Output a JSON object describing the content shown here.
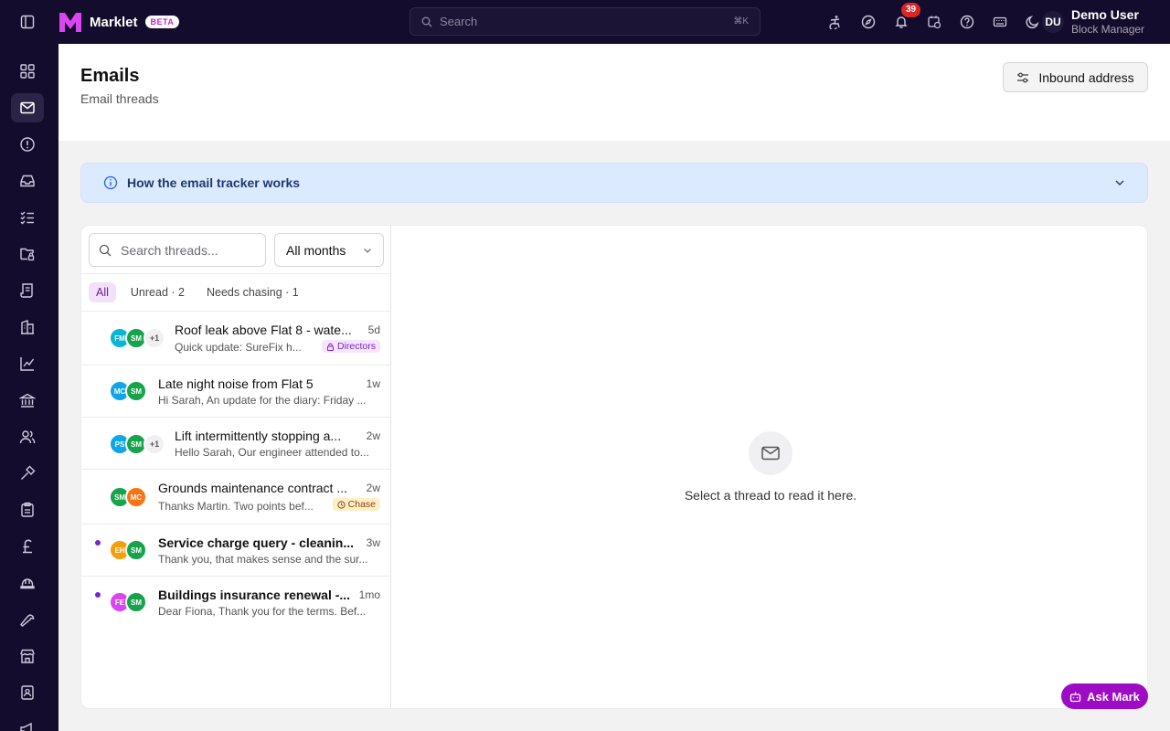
{
  "app": {
    "name": "Marklet",
    "badge": "BETA",
    "brand_color": "#c026d3"
  },
  "search": {
    "placeholder": "Search",
    "shortcut": "⌘K"
  },
  "top_icons": [
    "accessibility-icon",
    "compass-icon",
    "bell-icon",
    "calendar-clock-icon",
    "help-icon",
    "keyboard-icon",
    "moon-icon"
  ],
  "notifications": {
    "count": "39"
  },
  "user": {
    "initials": "DU",
    "name": "Demo User",
    "role": "Block Manager",
    "avatar_color": "#1f1a3a"
  },
  "nav": {
    "items": [
      "dashboard",
      "emails",
      "alerts",
      "inbox",
      "tasks",
      "folders",
      "documents",
      "buildings",
      "reports",
      "finance",
      "people",
      "hammer",
      "clipboard",
      "pound",
      "hard-hat",
      "wrench",
      "store",
      "contacts",
      "megaphone"
    ],
    "active": "emails"
  },
  "page": {
    "title": "Emails",
    "subtitle": "Email threads",
    "inbound_button": "Inbound address"
  },
  "banner": {
    "text": "How the email tracker works"
  },
  "list": {
    "search_placeholder": "Search threads...",
    "month_filter": "All months",
    "filters": [
      {
        "label": "All",
        "active": true
      },
      {
        "label": "Unread · 2",
        "active": false
      },
      {
        "label": "Needs chasing · 1",
        "active": false
      }
    ],
    "threads": [
      {
        "subject": "Roof leak above Flat 8 - wate...",
        "time": "5d",
        "preview": "Quick update: SureFix h...",
        "tag": "Directors",
        "unread": false,
        "avatars": [
          {
            "initials": "FM",
            "color": "#06b6d4"
          },
          {
            "initials": "SM",
            "color": "#16a34a"
          },
          {
            "initials": "+1",
            "color": "#f0f0f2"
          }
        ]
      },
      {
        "subject": "Late night noise from Flat 5",
        "time": "1w",
        "preview": "Hi Sarah, An update for the diary: Friday ...",
        "tag": "",
        "unread": false,
        "avatars": [
          {
            "initials": "MC",
            "color": "#0ea5e9"
          },
          {
            "initials": "SM",
            "color": "#16a34a"
          }
        ]
      },
      {
        "subject": "Lift intermittently stopping a...",
        "time": "2w",
        "preview": "Hello Sarah, Our engineer attended to...",
        "tag": "",
        "unread": false,
        "avatars": [
          {
            "initials": "PS",
            "color": "#0ea5e9"
          },
          {
            "initials": "SM",
            "color": "#16a34a"
          },
          {
            "initials": "+1",
            "color": "#f0f0f2"
          }
        ]
      },
      {
        "subject": "Grounds maintenance contract ...",
        "time": "2w",
        "preview": "Thanks Martin. Two points bef...",
        "tag": "Chase",
        "unread": false,
        "avatars": [
          {
            "initials": "SM",
            "color": "#16a34a"
          },
          {
            "initials": "MC",
            "color": "#f97316"
          }
        ]
      },
      {
        "subject": "Service charge query - cleanin...",
        "time": "3w",
        "preview": "Thank you, that makes sense and the sur...",
        "tag": "",
        "unread": true,
        "avatars": [
          {
            "initials": "EH",
            "color": "#f59e0b"
          },
          {
            "initials": "SM",
            "color": "#16a34a"
          }
        ]
      },
      {
        "subject": "Buildings insurance renewal -...",
        "time": "1mo",
        "preview": "Dear Fiona, Thank you for the terms. Bef...",
        "tag": "",
        "unread": true,
        "avatars": [
          {
            "initials": "FE",
            "color": "#d946ef"
          },
          {
            "initials": "SM",
            "color": "#16a34a"
          }
        ]
      }
    ]
  },
  "empty_state": {
    "text": "Select a thread to read it here."
  },
  "assistant": {
    "label": "Ask Mark"
  }
}
